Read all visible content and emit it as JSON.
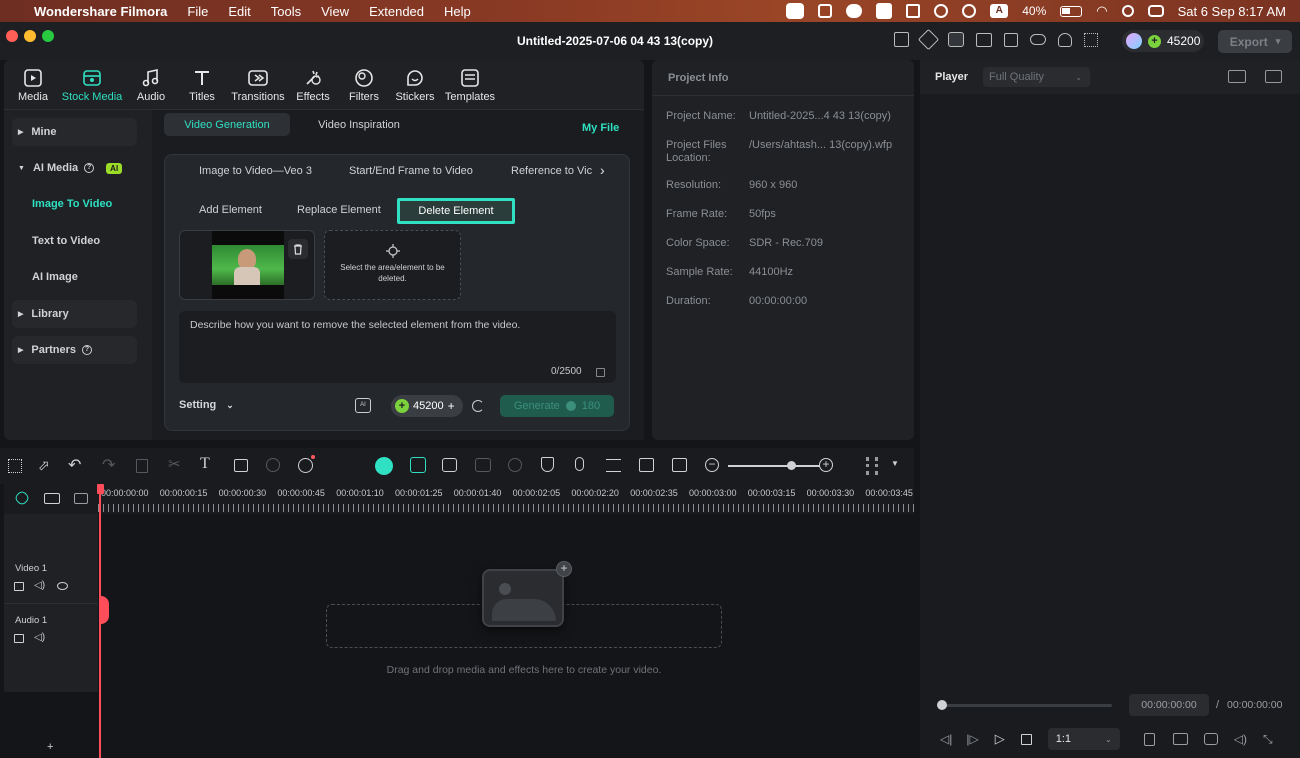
{
  "menubar": {
    "app": "Wondershare Filmora",
    "items": [
      "File",
      "Edit",
      "Tools",
      "View",
      "Extended",
      "Help"
    ],
    "battery": "40%",
    "datetime": "Sat 6 Sep  8:17 AM"
  },
  "window": {
    "title": "Untitled-2025-07-06 04 43 13(copy)",
    "credits": "45200",
    "export": "Export"
  },
  "toolbar": [
    {
      "label": "Media",
      "icon": "media-icon"
    },
    {
      "label": "Stock Media",
      "icon": "stock-media-icon"
    },
    {
      "label": "Audio",
      "icon": "audio-icon"
    },
    {
      "label": "Titles",
      "icon": "titles-icon"
    },
    {
      "label": "Transitions",
      "icon": "transitions-icon"
    },
    {
      "label": "Effects",
      "icon": "effects-icon"
    },
    {
      "label": "Filters",
      "icon": "filters-icon"
    },
    {
      "label": "Stickers",
      "icon": "stickers-icon"
    },
    {
      "label": "Templates",
      "icon": "templates-icon"
    }
  ],
  "sidebar": {
    "mine": "Mine",
    "ai_media": "AI Media",
    "ai_badge": "AI",
    "image_to_video": "Image To Video",
    "text_to_video": "Text to Video",
    "ai_image": "AI Image",
    "library": "Library",
    "partners": "Partners"
  },
  "gen": {
    "tab_video_generation": "Video Generation",
    "tab_video_inspiration": "Video Inspiration",
    "my_file": "My File",
    "modes": [
      "Image to Video—Veo 3",
      "Start/End Frame to Video",
      "Reference to Vic"
    ],
    "sub_add": "Add Element",
    "sub_replace": "Replace Element",
    "sub_delete": "Delete Element",
    "select_hint": "Select the area/element to be deleted.",
    "prompt_placeholder": "Describe how you want to remove the selected element from the video.",
    "counter": "0/2500",
    "setting": "Setting",
    "credits": "45200",
    "generate": "Generate",
    "generate_cost": "180"
  },
  "project": {
    "title": "Project Info",
    "rows": [
      {
        "label": "Project Name:",
        "value": "Untitled-2025...4 43 13(copy)"
      },
      {
        "label": "Project Files Location:",
        "value": "/Users/ahtash... 13(copy).wfp"
      },
      {
        "label": "Resolution:",
        "value": "960 x 960"
      },
      {
        "label": "Frame Rate:",
        "value": "50fps"
      },
      {
        "label": "Color Space:",
        "value": "SDR - Rec.709"
      },
      {
        "label": "Sample Rate:",
        "value": "44100Hz"
      },
      {
        "label": "Duration:",
        "value": "00:00:00:00"
      }
    ]
  },
  "player": {
    "label": "Player",
    "quality": "Full Quality",
    "time_current": "00:00:00:00",
    "time_sep": "/",
    "time_total": "00:00:00:00",
    "ratio": "1:1"
  },
  "timeline": {
    "ticks": [
      "00:00:00:00",
      "00:00:00:15",
      "00:00:00:30",
      "00:00:00:45",
      "00:00:01:10",
      "00:00:01:25",
      "00:00:01:40",
      "00:00:02:05",
      "00:00:02:20",
      "00:00:02:35",
      "00:00:03:00",
      "00:00:03:15",
      "00:00:03:30",
      "00:00:03:45"
    ],
    "video_track": "Video 1",
    "audio_track": "Audio 1",
    "drop_hint": "Drag and drop media and effects here to create your video.",
    "zoom_level": 0.82
  }
}
